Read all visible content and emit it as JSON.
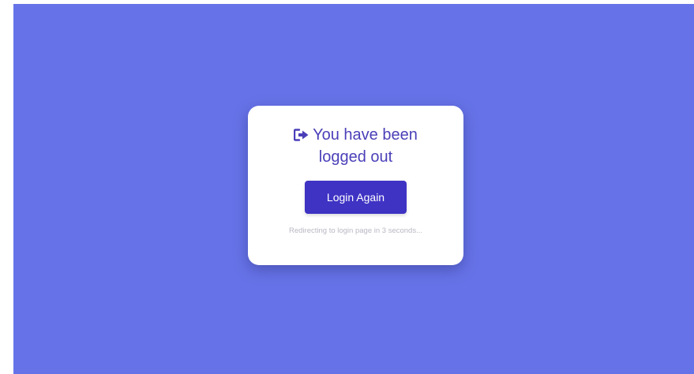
{
  "logout_card": {
    "title_line1": "You have been",
    "title_line2": "logged out",
    "icon": "sign-out-icon",
    "login_button_label": "Login Again",
    "redirect_message": "Redirecting to login page in 3 seconds..."
  },
  "colors": {
    "background": "#6673e8",
    "card": "#ffffff",
    "title": "#4a3fb8",
    "button": "#3f33c4",
    "note": "#b8b8c4"
  }
}
